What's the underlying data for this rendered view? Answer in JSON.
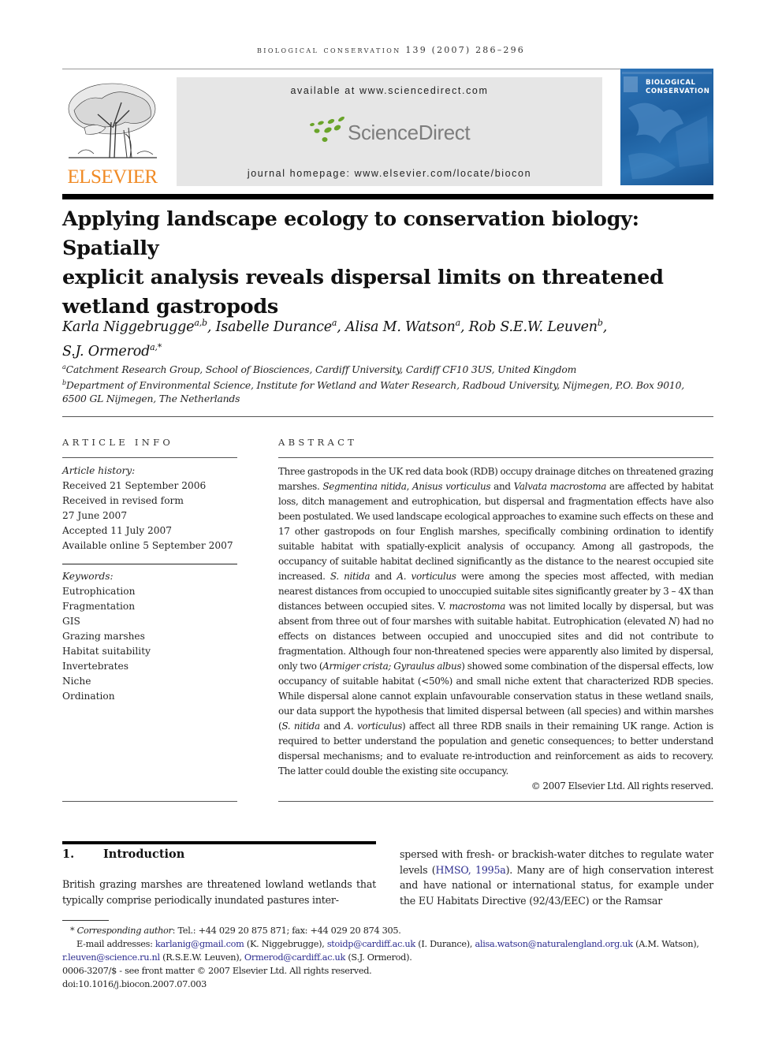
{
  "running_head": {
    "journal": "biological conservation",
    "citation": "139 (2007) 286–296"
  },
  "header": {
    "publisher_logo_text": "ELSEVIER",
    "available_at": "available at www.sciencedirect.com",
    "sciencedirect_logo_text": "ScienceDirect",
    "journal_homepage": "journal homepage: www.elsevier.com/locate/biocon",
    "cover_title_line1": "BIOLOGICAL",
    "cover_title_line2": "CONSERVATION",
    "colors": {
      "elsevier_orange": "#f08a24",
      "sciencedirect_green": "#6aa42a",
      "cover_blue": "#2268ab",
      "link_blue": "#2d2d8f"
    }
  },
  "article": {
    "title_line1": "Applying landscape ecology to conservation biology: Spatially",
    "title_line2": "explicit analysis reveals dispersal limits on threatened",
    "title_line3": "wetland gastropods",
    "authors": [
      {
        "name": "Karla Niggebrugge",
        "sup": "a,b",
        "sep": ", "
      },
      {
        "name": "Isabelle Durance",
        "sup": "a",
        "sep": ", "
      },
      {
        "name": "Alisa M. Watson",
        "sup": "a",
        "sep": ", "
      },
      {
        "name": "Rob S.E.W. Leuven",
        "sup": "b",
        "sep": ","
      },
      {
        "name": "S.J. Ormerod",
        "sup": "a,*",
        "sep": ""
      }
    ],
    "affiliations": [
      {
        "sup": "a",
        "text": "Catchment Research Group, School of Biosciences, Cardiff University, Cardiff CF10 3US, United Kingdom"
      },
      {
        "sup": "b",
        "text": "Department of Environmental Science, Institute for Wetland and Water Research, Radboud University, Nijmegen, P.O. Box 9010,",
        "text_cont": "6500 GL Nijmegen, The Netherlands"
      }
    ]
  },
  "article_info": {
    "heading": "ARTICLE INFO",
    "history_label": "Article history:",
    "history": [
      "Received 21 September 2006",
      "Received in revised form",
      "27 June 2007",
      "Accepted 11 July 2007",
      "Available online 5 September 2007"
    ],
    "keywords_label": "Keywords:",
    "keywords": [
      "Eutrophication",
      "Fragmentation",
      "GIS",
      "Grazing marshes",
      "Habitat suitability",
      "Invertebrates",
      "Niche",
      "Ordination"
    ]
  },
  "abstract": {
    "heading": "ABSTRACT",
    "segments": [
      {
        "t": "Three gastropods in the UK red data book (RDB) occupy drainage ditches on threatened grazing marshes. "
      },
      {
        "t": "Segmentina nitida",
        "i": true
      },
      {
        "t": ", "
      },
      {
        "t": "Anisus vorticulus",
        "i": true
      },
      {
        "t": " and "
      },
      {
        "t": "Valvata macrostoma",
        "i": true
      },
      {
        "t": " are affected by habitat loss, ditch management and eutrophication, but dispersal and fragmentation effects have also been postulated. We used landscape ecological approaches to examine such effects on these and 17 other gastropods on four English marshes, specifically combining ordination to identify suitable habitat with spatially-explicit analysis of occupancy. Among all gastropods, the occupancy of suitable habitat declined significantly as the distance to the nearest occupied site increased. "
      },
      {
        "t": "S. nitida",
        "i": true
      },
      {
        "t": " and "
      },
      {
        "t": "A. vorticulus",
        "i": true
      },
      {
        "t": " were among the species most affected, with median nearest distances from occupied to unoccupied suitable sites significantly greater by 3 – 4X than distances between occupied sites. V. "
      },
      {
        "t": "macrostoma",
        "i": true
      },
      {
        "t": " was not limited locally by dispersal, but was absent from three out of four marshes with suitable habitat. Eutrophication (elevated "
      },
      {
        "t": "N",
        "i": true
      },
      {
        "t": ") had no effects on distances between occupied and unoccupied sites and did not contribute to fragmentation. Although four non-threatened species were apparently also limited by dispersal, only two ("
      },
      {
        "t": "Armiger crista; Gyraulus albus",
        "i": true
      },
      {
        "t": ") showed some combination of the dispersal effects, low occupancy of suitable habitat (<50%) and small niche extent that characterized RDB species. While dispersal alone cannot explain unfavourable conservation status in these wetland snails, our data support the hypothesis that limited dispersal between (all species) and within marshes ("
      },
      {
        "t": "S. nitida",
        "i": true
      },
      {
        "t": " and "
      },
      {
        "t": "A. vorticulus",
        "i": true
      },
      {
        "t": ") affect all three RDB snails in their remaining UK range. Action is required to better understand the population and genetic consequences; to better understand dispersal mechanisms; and to evaluate re-introduction and reinforcement as aids to recovery. The latter could double the existing site occupancy."
      }
    ],
    "copyright": "© 2007 Elsevier Ltd. All rights reserved."
  },
  "introduction": {
    "number": "1.",
    "heading": "Introduction",
    "left_col": "British grazing marshes are threatened lowland wetlands that typically comprise periodically inundated pastures inter-",
    "right_col_before": "spersed with fresh- or brackish-water ditches to regulate water levels (",
    "right_col_link": "HMSO, 1995a",
    "right_col_after": "). Many are of high conservation interest and have national or international status, for example under the EU Habitats Directive (92/43/EEC) or the Ramsar"
  },
  "footnotes": {
    "corresponding_label": "Corresponding author",
    "corresponding_text": ": Tel.: +44 029 20 875 871; fax: +44 029 20 874 305.",
    "email_label": "E-mail addresses: ",
    "emails": [
      {
        "email": "karlanig@gmail.com",
        "who": " (K. Niggebrugge), "
      },
      {
        "email": "stoidp@cardiff.ac.uk",
        "who": " (I. Durance), "
      },
      {
        "email": "alisa.watson@naturalengland.org.uk",
        "who": " (A.M. Watson), "
      },
      {
        "email": "r.leuven@science.ru.nl",
        "who": " (R.S.E.W. Leuven), "
      },
      {
        "email": "Ormerod@cardiff.ac.uk",
        "who": " (S.J. Ormerod)."
      }
    ],
    "front_matter": "0006-3207/$ - see front matter © 2007 Elsevier Ltd. All rights reserved.",
    "doi": "doi:10.1016/j.biocon.2007.07.003"
  }
}
